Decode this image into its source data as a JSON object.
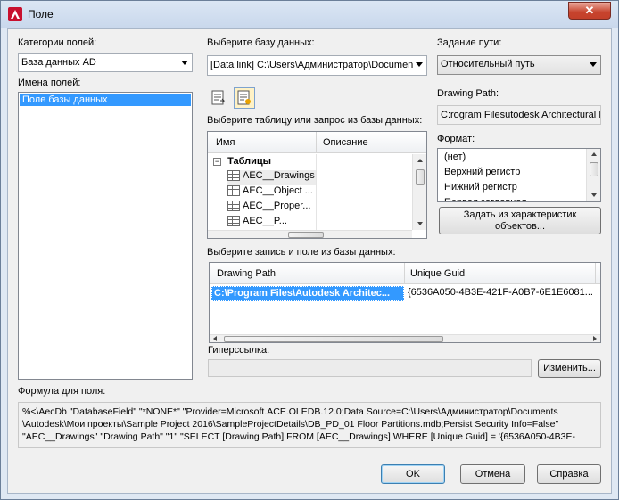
{
  "window": {
    "title": "Поле",
    "close_label": "✕"
  },
  "left": {
    "categories_label": "Категории полей:",
    "category_value": "База данных AD",
    "fieldnames_label": "Имена полей:",
    "fieldnames_items": [
      "Поле базы данных"
    ]
  },
  "db": {
    "select_db_label": "Выберите базу данных:",
    "db_value": "[Data link] C:\\Users\\Администратор\\Documen",
    "select_table_label": "Выберите таблицу или запрос из базы данных:",
    "table_headers": [
      "Имя",
      "Описание"
    ],
    "tree_group": "Таблицы",
    "tree_items": [
      "AEC__Drawings",
      "AEC__Object ...",
      "AEC__Proper...",
      "AEC__P..."
    ],
    "select_record_label": "Выберите запись и поле из базы данных:",
    "record_headers": [
      "Drawing Path",
      "Unique Guid"
    ],
    "record_row": [
      "C:\\Program Files\\Autodesk Architec...",
      "{6536A050-4B3E-421F-A0B7-6E1E6081..."
    ],
    "hyperlink_label": "Гиперссылка:",
    "change_button": "Изменить..."
  },
  "right": {
    "path_label": "Задание пути:",
    "path_value": "Относительный путь",
    "drawing_path_label": "Drawing Path:",
    "drawing_path_value": "C:rogram Filesutodesk Architectural I",
    "format_label": "Формат:",
    "format_items": [
      "(нет)",
      "Верхний регистр",
      "Нижний регистр",
      "Первая заглавная..."
    ],
    "from_props_button_line1": "Задать из характеристик",
    "from_props_button_line2": "объектов..."
  },
  "formula": {
    "label": "Формула для поля:",
    "lines": [
      "%<\\AecDb \"DatabaseField\" \"*NONE*\" \"Provider=Microsoft.ACE.OLEDB.12.0;Data Source=C:\\Users\\Администратор\\Documents",
      "\\Autodesk\\Мои проекты\\Sample Project 2016\\SampleProjectDetails\\DB_PD_01 Floor Partitions.mdb;Persist Security Info=False\"",
      "\"AEC__Drawings\" \"Drawing Path\" \"1\" \"SELECT [Drawing Path] FROM [AEC__Drawings] WHERE [Unique Guid] = '{6536A050-4B3E-"
    ]
  },
  "buttons": {
    "ok": "OK",
    "cancel": "Отмена",
    "help": "Справка"
  }
}
